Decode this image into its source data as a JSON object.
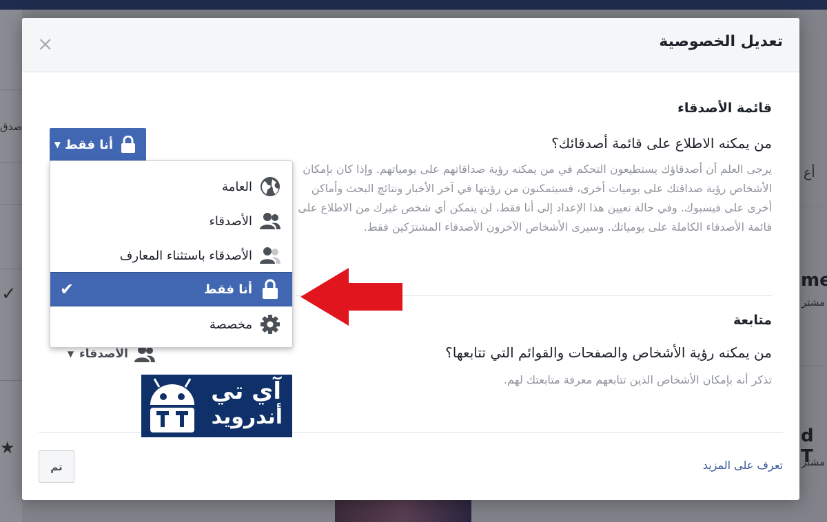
{
  "dialog": {
    "title": "تعديل الخصوصية",
    "close_symbol": "×"
  },
  "friends_section": {
    "title": "قائمة الأصدقاء",
    "question": "من يمكنه الاطلاع على قائمة أصدقائك؟",
    "description": "يرجى العلم أن أصدقاؤك يستطيعون التحكم في من يمكنه رؤية صداقاتهم على يومياتهم. وإذا كان بإمكان الأشخاص رؤية صداقتك على يوميات أخرى، فسيتمكنون من رؤيتها في آخر الأخبار ونتائج البحث وأماكن أخرى على فيسبوك. وفي حالة تعيين هذا الإعداد إلى أنا فقط، لن يتمكن أي شخص غيرك من الاطلاع على قائمة الأصدقاء الكاملة على يومياتك. وسيرى الأشخاص الآخرون الأصدقاء المشترَكين فقط.",
    "selector_label": "أنا فقط",
    "selector_icon": "lock-icon"
  },
  "privacy_menu": {
    "items": [
      {
        "label": "العامة",
        "icon": "globe-icon",
        "selected": false
      },
      {
        "label": "الأصدقاء",
        "icon": "friends-icon",
        "selected": false
      },
      {
        "label": "الأصدقاء باستثناء المعارف",
        "icon": "friends-except-icon",
        "selected": false
      },
      {
        "label": "أنا فقط",
        "icon": "lock-icon",
        "selected": true
      },
      {
        "label": "مخصصة",
        "icon": "gear-icon",
        "selected": false
      }
    ],
    "check_symbol": "✔"
  },
  "following_section": {
    "title": "متابعة",
    "question": "من يمكنه رؤية الأشخاص والصفحات والقوائم التي تتابعها؟",
    "description": "تذكر أنه بإمكان الأشخاص الذين تتابعهم معرفة متابعتك لهم.",
    "selector_label": "الأصدقاء",
    "selector_icon": "friends-icon"
  },
  "logo": {
    "line1": "آي تي",
    "line2": "أندرويد"
  },
  "footer": {
    "learn_more": "تعرف على المزيد",
    "done": "تم"
  },
  "background_fragments": {
    "right_1": "أع",
    "right_2": "me",
    "right_3": "مشتر",
    "right_4": "d T",
    "right_5": "مشتر",
    "left_1": "صدق"
  },
  "colors": {
    "accent": "#4267b2",
    "arrow": "#e0151e",
    "logo_bg": "#10306a"
  }
}
